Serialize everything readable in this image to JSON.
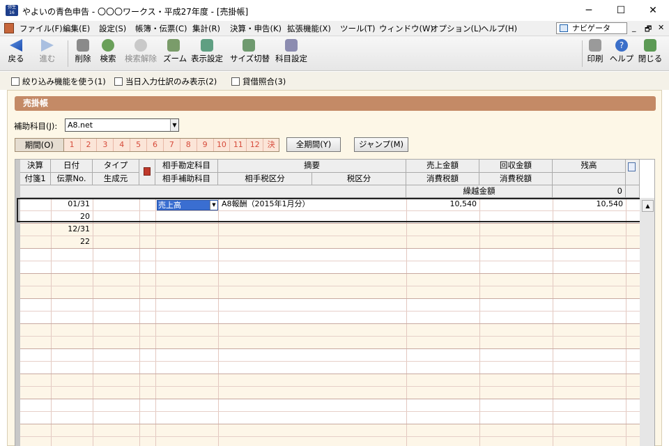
{
  "window": {
    "app_icon_text": "弥生16",
    "title": "やよいの青色申告 - 〇〇〇ワークス・平成27年度 - [売掛帳]",
    "minimize": "─",
    "maximize": "☐",
    "close": "✕"
  },
  "menu": {
    "items": [
      "ファイル(F)",
      "編集(E)",
      "設定(S)",
      "帳簿・伝票(C)",
      "集計(R)",
      "決算・申告(K)",
      "拡張機能(X)",
      "ツール(T)",
      "ウィンドウ(W)",
      "オプション(L)",
      "ヘルプ(H)"
    ],
    "navigator": "ナビゲータ",
    "mdi_min": "_",
    "mdi_restore": "🗗",
    "mdi_close": "✕"
  },
  "toolbar": {
    "back": "戻る",
    "forward": "進む",
    "delete": "削除",
    "search": "検索",
    "clear_search": "検索解除",
    "zoom": "ズーム",
    "display_settings": "表示設定",
    "size_toggle": "サイズ切替",
    "account_settings": "科目設定",
    "print": "印刷",
    "help": "ヘルプ",
    "close": "閉じる"
  },
  "options": {
    "filter": "絞り込み機能を使う(1)",
    "today_only": "当日入力仕訳のみ表示(2)",
    "balance_check": "貸借照合(3)"
  },
  "ledger": {
    "title": "売掛帳",
    "sub_account_label": "補助科目(J):",
    "sub_account_value": "A8.net",
    "period_label": "期間(O)",
    "months": [
      "1",
      "2",
      "3",
      "4",
      "5",
      "6",
      "7",
      "8",
      "9",
      "10",
      "11",
      "12",
      "決"
    ],
    "all_period_button": "全期間(Y)",
    "jump_button": "ジャンプ(M)"
  },
  "grid": {
    "headers": {
      "kessan": "決算",
      "fusen": "付箋1",
      "date": "日付",
      "slip_no": "伝票No.",
      "type": "タイプ",
      "source": "生成元",
      "counter_account": "相手勘定科目",
      "counter_sub": "相手補助科目",
      "description": "摘要",
      "counter_tax": "相手税区分",
      "tax": "税区分",
      "sales": "売上金額",
      "sales_tax": "消費税額",
      "collected": "回収金額",
      "collected_tax": "消費税額",
      "balance": "残高"
    },
    "carryover_label": "繰越金額",
    "carryover_value": "0",
    "rows": [
      {
        "date": "01/31",
        "slip_no": "20",
        "counter_account": "売上高",
        "description": "A8報酬（2015年1月分）",
        "sales": "10,540",
        "balance": "10,540"
      },
      {
        "date": "12/31",
        "slip_no": "22",
        "counter_account": "",
        "description": "",
        "sales": "",
        "balance": ""
      }
    ]
  }
}
